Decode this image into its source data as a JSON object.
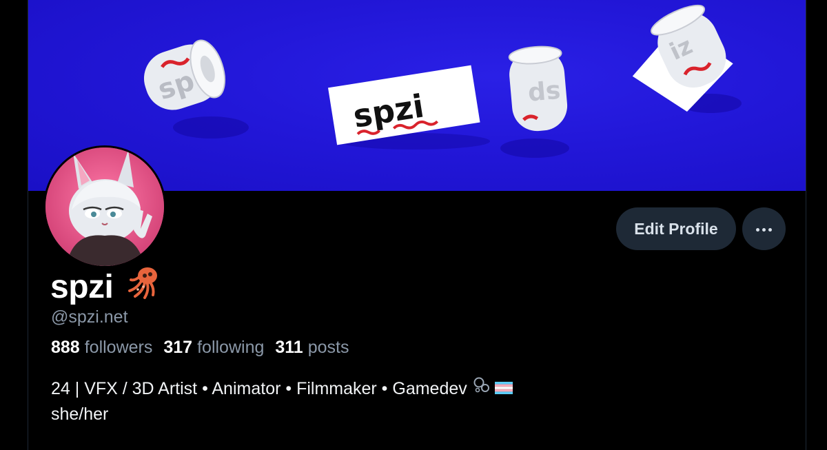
{
  "banner": {
    "logo_text": "spzi",
    "background_color": "#2117d6"
  },
  "profile": {
    "display_name": "spzi",
    "name_emoji": "squid",
    "handle": "@spzi.net",
    "stats": {
      "followers_count": "888",
      "followers_label": "followers",
      "following_count": "317",
      "following_label": "following",
      "posts_count": "311",
      "posts_label": "posts"
    },
    "bio": {
      "line1": "24 | VFX / 3D Artist • Animator • Filmmaker • Gamedev",
      "line1_icons": [
        "bubbles-icon",
        "transgender-flag-icon"
      ],
      "line2": "she/her"
    }
  },
  "actions": {
    "edit_profile_label": "Edit Profile",
    "more_icon": "ellipsis-icon"
  },
  "colors": {
    "background": "#000000",
    "button_bg": "#1e2936",
    "muted_text": "#8b98a8",
    "accent_red": "#d9232c"
  }
}
